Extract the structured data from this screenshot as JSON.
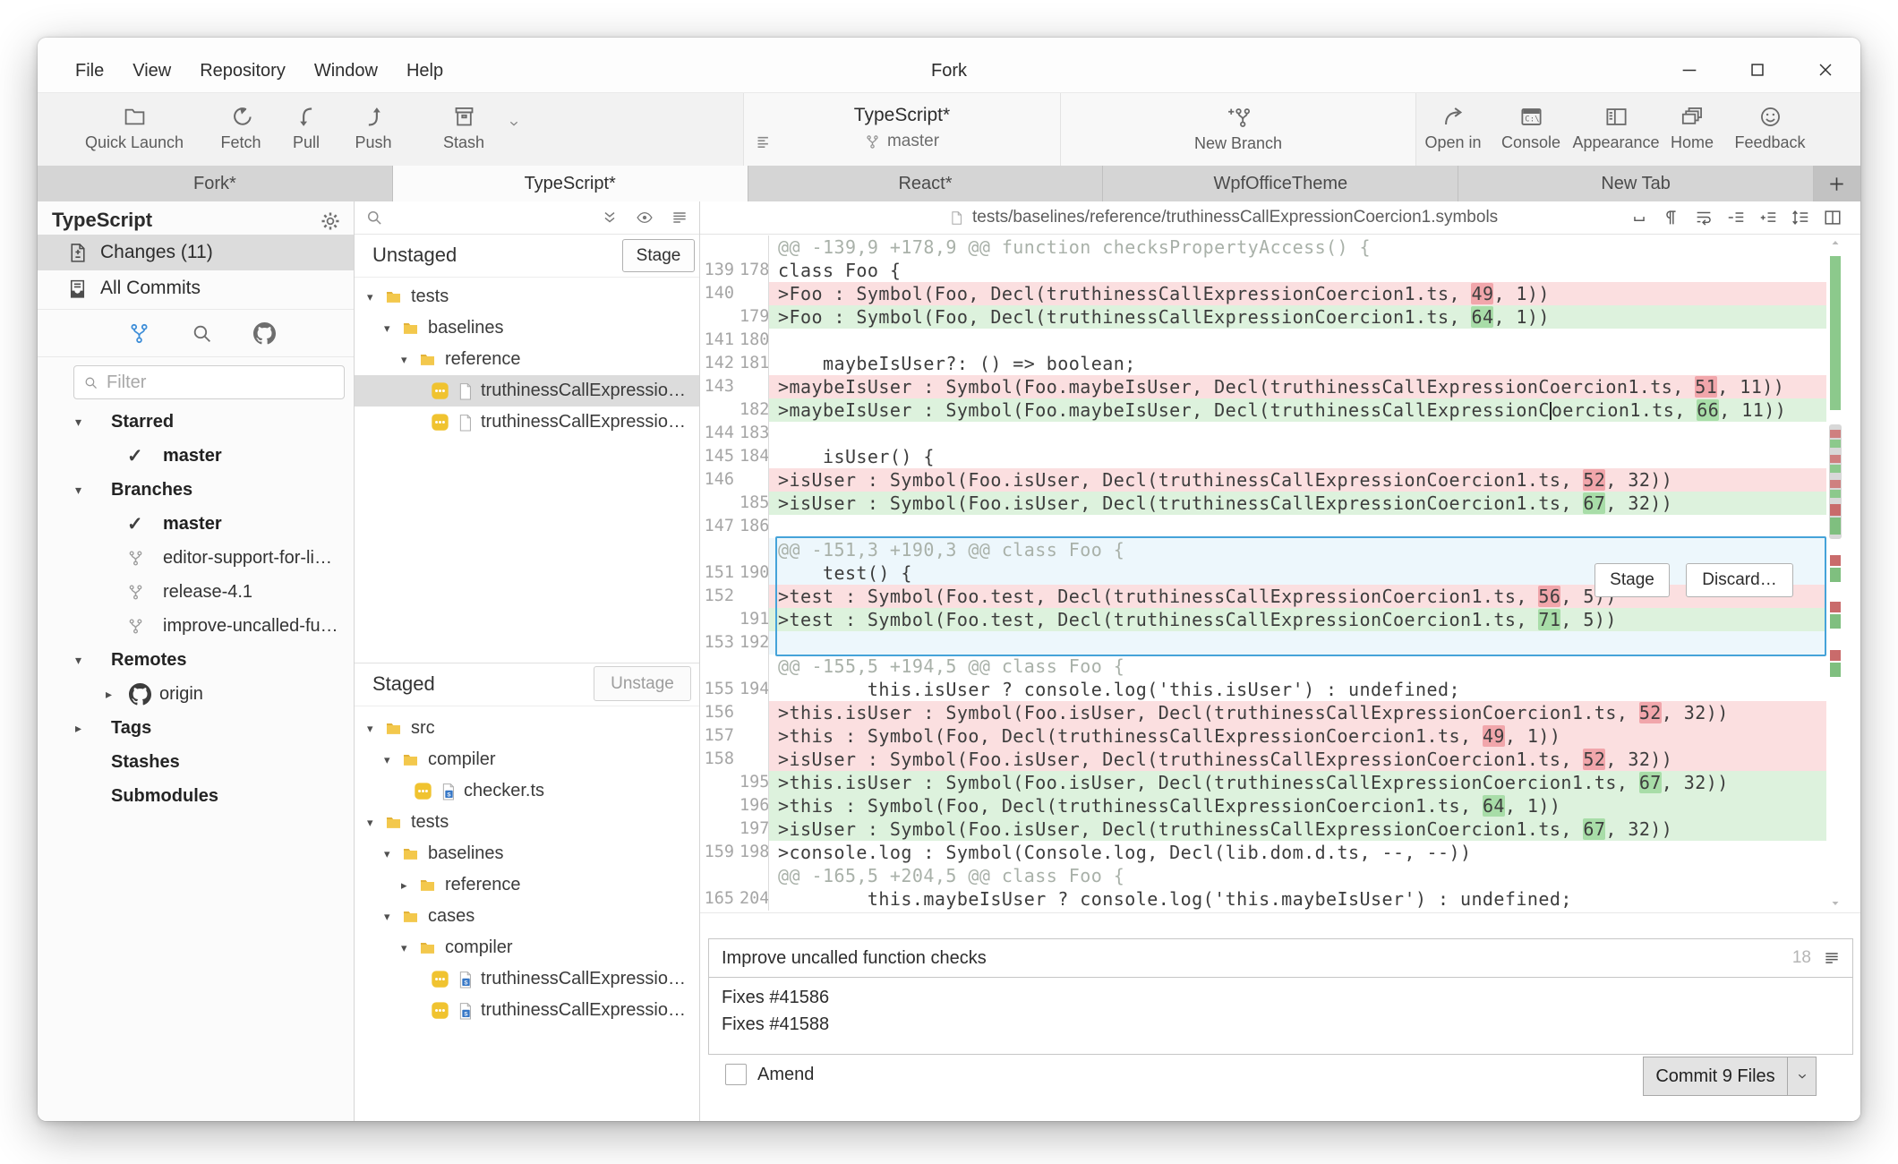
{
  "window": {
    "title": "Fork",
    "menu": [
      "File",
      "View",
      "Repository",
      "Window",
      "Help"
    ]
  },
  "toolbar": {
    "items_left": [
      {
        "label": "Quick Launch",
        "icon": "folder-open"
      },
      {
        "label": "Fetch",
        "icon": "fetch"
      },
      {
        "label": "Pull",
        "icon": "pull"
      },
      {
        "label": "Push",
        "icon": "push"
      },
      {
        "label": "Stash",
        "icon": "stash",
        "has_dropdown": true
      }
    ],
    "repo": {
      "name": "TypeScript*",
      "branch": "master"
    },
    "new_branch_label": "New Branch",
    "items_right": [
      {
        "label": "Open in",
        "icon": "open-in"
      },
      {
        "label": "Console",
        "icon": "console"
      },
      {
        "label": "Appearance",
        "icon": "appearance"
      },
      {
        "label": "Home",
        "icon": "home"
      },
      {
        "label": "Feedback",
        "icon": "feedback"
      }
    ]
  },
  "tabs": {
    "items": [
      "Fork*",
      "TypeScript*",
      "React*",
      "WpfOfficeTheme",
      "New Tab"
    ],
    "active_index": 1
  },
  "sidebar": {
    "repo_title": "TypeScript",
    "nav": [
      {
        "label": "Changes (11)",
        "icon": "changes",
        "selected": true
      },
      {
        "label": "All Commits",
        "icon": "commits",
        "selected": false
      }
    ],
    "mode_tabs": [
      {
        "name": "branches",
        "icon": "branch",
        "active": true
      },
      {
        "name": "search",
        "icon": "search",
        "active": false
      },
      {
        "name": "github",
        "icon": "github",
        "active": false
      }
    ],
    "filter_placeholder": "Filter",
    "tree": [
      {
        "label": "Starred",
        "type": "section",
        "arrow": "down"
      },
      {
        "label": "master",
        "type": "current"
      },
      {
        "label": "Branches",
        "type": "section",
        "arrow": "down"
      },
      {
        "label": "master",
        "type": "current"
      },
      {
        "label": "editor-support-for-li…",
        "type": "branch"
      },
      {
        "label": "release-4.1",
        "type": "branch"
      },
      {
        "label": "improve-uncalled-fu…",
        "type": "branch"
      },
      {
        "label": "Remotes",
        "type": "section",
        "arrow": "down"
      },
      {
        "label": "origin",
        "type": "remote",
        "arrow": "right"
      },
      {
        "label": "Tags",
        "type": "section",
        "arrow": "right"
      },
      {
        "label": "Stashes",
        "type": "section"
      },
      {
        "label": "Submodules",
        "type": "section"
      }
    ]
  },
  "changes": {
    "unstaged": {
      "title": "Unstaged",
      "button_label": "Stage",
      "tree": [
        {
          "label": "tests",
          "type": "folder",
          "indent": 0,
          "arrow": "down"
        },
        {
          "label": "baselines",
          "type": "folder",
          "indent": 1,
          "arrow": "down"
        },
        {
          "label": "reference",
          "type": "folder",
          "indent": 2,
          "arrow": "down"
        },
        {
          "label": "truthinessCallExpression…",
          "type": "file",
          "indent": 3,
          "selected": true
        },
        {
          "label": "truthinessCallExpression…",
          "type": "file",
          "indent": 3
        }
      ]
    },
    "staged": {
      "title": "Staged",
      "button_label": "Unstage",
      "tree": [
        {
          "label": "src",
          "type": "folder",
          "indent": 0,
          "arrow": "down"
        },
        {
          "label": "compiler",
          "type": "folder",
          "indent": 1,
          "arrow": "down"
        },
        {
          "label": "checker.ts",
          "type": "file-ts",
          "indent": 2
        },
        {
          "label": "tests",
          "type": "folder",
          "indent": 0,
          "arrow": "down"
        },
        {
          "label": "baselines",
          "type": "folder",
          "indent": 1,
          "arrow": "down"
        },
        {
          "label": "reference",
          "type": "folder",
          "indent": 2,
          "arrow": "right"
        },
        {
          "label": "cases",
          "type": "folder",
          "indent": 1,
          "arrow": "down"
        },
        {
          "label": "compiler",
          "type": "folder",
          "indent": 2,
          "arrow": "down"
        },
        {
          "label": "truthinessCallExpression…",
          "type": "file-ts",
          "indent": 3
        },
        {
          "label": "truthinessCallExpression…",
          "type": "file-ts",
          "indent": 3
        }
      ]
    }
  },
  "diff": {
    "file_path": "tests/baselines/reference/truthinessCallExpressionCoercion1.symbols",
    "hunk_actions": {
      "stage": "Stage",
      "discard": "Discard…"
    },
    "rows": [
      {
        "t": "hunk",
        "text": "@@ -139,9 +178,9 @@ function checksPropertyAccess() {"
      },
      {
        "t": "ctx",
        "old": "139",
        "new": "178",
        "text": "class Foo {"
      },
      {
        "t": "del",
        "old": "140",
        "text": ">Foo : Symbol(Foo, Decl(truthinessCallExpressionCoercion1.ts, 49, 1))",
        "hl": "49"
      },
      {
        "t": "add",
        "new": "179",
        "text": ">Foo : Symbol(Foo, Decl(truthinessCallExpressionCoercion1.ts, 64, 1))",
        "hl": "64"
      },
      {
        "t": "ctx",
        "old": "141",
        "new": "180",
        "text": ""
      },
      {
        "t": "ctx",
        "old": "142",
        "new": "181",
        "text": "    maybeIsUser?: () => boolean;"
      },
      {
        "t": "del",
        "old": "143",
        "text": ">maybeIsUser : Symbol(Foo.maybeIsUser, Decl(truthinessCallExpressionCoercion1.ts, 51, 11))",
        "hl": "51"
      },
      {
        "t": "add",
        "new": "182",
        "text": ">maybeIsUser : Symbol(Foo.maybeIsUser, Decl(truthinessCallExpressionCoercion1.ts, 66, 11))",
        "hl": "66",
        "caret": 69
      },
      {
        "t": "ctx",
        "old": "144",
        "new": "183",
        "text": ""
      },
      {
        "t": "ctx",
        "old": "145",
        "new": "184",
        "text": "    isUser() {"
      },
      {
        "t": "del",
        "old": "146",
        "text": ">isUser : Symbol(Foo.isUser, Decl(truthinessCallExpressionCoercion1.ts, 52, 32))",
        "hl": "52"
      },
      {
        "t": "add",
        "new": "185",
        "text": ">isUser : Symbol(Foo.isUser, Decl(truthinessCallExpressionCoercion1.ts, 67, 32))",
        "hl": "67"
      },
      {
        "t": "ctx",
        "old": "147",
        "new": "186",
        "text": ""
      },
      {
        "t": "hunk",
        "text": "@@ -151,3 +190,3 @@ class Foo {",
        "inbox": true
      },
      {
        "t": "ctx",
        "old": "151",
        "new": "190",
        "text": "    test() {",
        "inbox": true
      },
      {
        "t": "del",
        "old": "152",
        "text": ">test : Symbol(Foo.test, Decl(truthinessCallExpressionCoercion1.ts, 56, 5))",
        "hl": "56",
        "inbox": true
      },
      {
        "t": "add",
        "new": "191",
        "text": ">test : Symbol(Foo.test, Decl(truthinessCallExpressionCoercion1.ts, 71, 5))",
        "hl": "71",
        "inbox": true
      },
      {
        "t": "ctx",
        "old": "153",
        "new": "192",
        "text": "",
        "inbox": true
      },
      {
        "t": "hunk",
        "text": "@@ -155,5 +194,5 @@ class Foo {"
      },
      {
        "t": "ctx",
        "old": "155",
        "new": "194",
        "text": "        this.isUser ? console.log('this.isUser') : undefined;"
      },
      {
        "t": "del",
        "old": "156",
        "text": ">this.isUser : Symbol(Foo.isUser, Decl(truthinessCallExpressionCoercion1.ts, 52, 32))",
        "hl": "52"
      },
      {
        "t": "del",
        "old": "157",
        "text": ">this : Symbol(Foo, Decl(truthinessCallExpressionCoercion1.ts, 49, 1))",
        "hl": "49"
      },
      {
        "t": "del",
        "old": "158",
        "text": ">isUser : Symbol(Foo.isUser, Decl(truthinessCallExpressionCoercion1.ts, 52, 32))",
        "hl": "52"
      },
      {
        "t": "add",
        "new": "195",
        "text": ">this.isUser : Symbol(Foo.isUser, Decl(truthinessCallExpressionCoercion1.ts, 67, 32))",
        "hl": "67"
      },
      {
        "t": "add",
        "new": "196",
        "text": ">this : Symbol(Foo, Decl(truthinessCallExpressionCoercion1.ts, 64, 1))",
        "hl": "64"
      },
      {
        "t": "add",
        "new": "197",
        "text": ">isUser : Symbol(Foo.isUser, Decl(truthinessCallExpressionCoercion1.ts, 67, 32))",
        "hl": "67"
      },
      {
        "t": "ctx",
        "old": "159",
        "new": "198",
        "text": ">console.log : Symbol(Console.log, Decl(lib.dom.d.ts, --, --))"
      },
      {
        "t": "hunk",
        "text": "@@ -165,5 +204,5 @@ class Foo {"
      },
      {
        "t": "ctx",
        "old": "165",
        "new": "204",
        "text": "        this.maybeIsUser ? console.log('this.maybeIsUser') : undefined;"
      }
    ]
  },
  "commit": {
    "subject": "Improve uncalled function checks",
    "subject_counter": "18",
    "body_lines": [
      "Fixes #41586",
      "Fixes #41588"
    ],
    "amend_label": "Amend",
    "commit_button_label": "Commit 9 Files"
  },
  "colors": {
    "accent_blue": "#45a3d9",
    "deleted_bg": "#fbdfe0",
    "deleted_hl": "#f1a6ab",
    "added_bg": "#ddf2dd",
    "added_hl": "#a8dda8",
    "badge_yellow": "#f0c330",
    "folder_yellow": "#f3c84c",
    "selection_gray": "#dcdcdc",
    "ts_blue": "#3677c6"
  }
}
